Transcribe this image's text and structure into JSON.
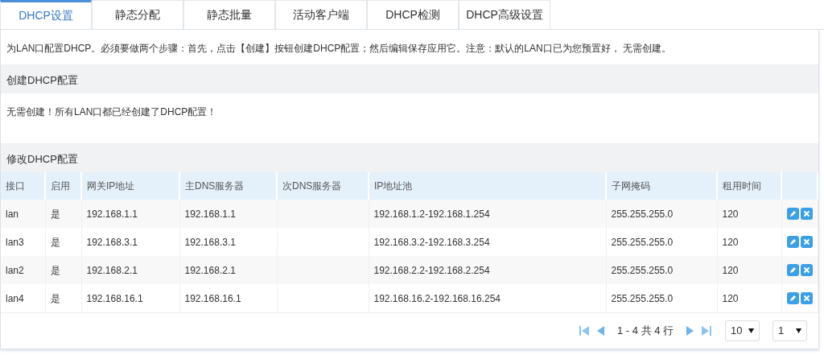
{
  "tabs": [
    {
      "label": "DHCP设置",
      "selected": true
    },
    {
      "label": "静态分配",
      "selected": false
    },
    {
      "label": "静态批量",
      "selected": false
    },
    {
      "label": "活动客户端",
      "selected": false
    },
    {
      "label": "DHCP检测",
      "selected": false
    },
    {
      "label": "DHCP高级设置",
      "selected": false
    }
  ],
  "description": "为LAN口配置DHCP。必须要做两个步骤：首先，点击【创建】按钮创建DHCP配置；然后编辑保存应用它。注意：默认的LAN口已为您预置好， 无需创建。",
  "create_section": {
    "title": "创建DHCP配置",
    "message": "无需创建！所有LAN口都已经创建了DHCP配置！"
  },
  "edit_section": {
    "title": "修改DHCP配置"
  },
  "table": {
    "columns": [
      "接口",
      "启用",
      "网关IP地址",
      "主DNS服务器",
      "次DNS服务器",
      "IP地址池",
      "子网掩码",
      "租用时间"
    ],
    "rows": [
      {
        "cells": [
          "lan",
          "是",
          "192.168.1.1",
          "192.168.1.1",
          "",
          "192.168.1.2-192.168.1.254",
          "255.255.255.0",
          "120"
        ]
      },
      {
        "cells": [
          "lan3",
          "是",
          "192.168.3.1",
          "192.168.3.1",
          "",
          "192.168.3.2-192.168.3.254",
          "255.255.255.0",
          "120"
        ]
      },
      {
        "cells": [
          "lan2",
          "是",
          "192.168.2.1",
          "192.168.2.1",
          "",
          "192.168.2.2-192.168.2.254",
          "255.255.255.0",
          "120"
        ]
      },
      {
        "cells": [
          "lan4",
          "是",
          "192.168.16.1",
          "192.168.16.1",
          "",
          "192.168.16.2-192.168.16.254",
          "255.255.255.0",
          "120"
        ]
      }
    ]
  },
  "pager": {
    "info": "1 - 4 共 4 行",
    "page_size": "10",
    "page": "1"
  }
}
